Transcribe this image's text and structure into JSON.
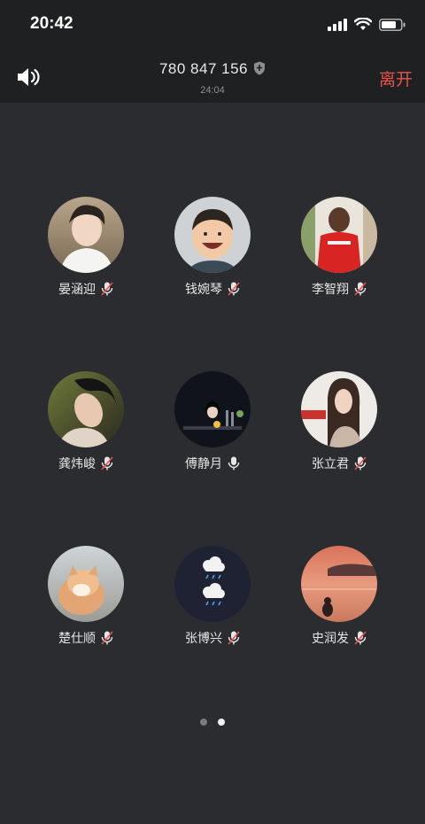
{
  "status": {
    "time": "20:42"
  },
  "header": {
    "meeting_id": "780 847 156",
    "duration": "24:04",
    "leave_label": "离开"
  },
  "participants": [
    {
      "name": "晏涵迎",
      "muted": true
    },
    {
      "name": "钱婉琴",
      "muted": true
    },
    {
      "name": "李智翔",
      "muted": true
    },
    {
      "name": "龚炜峻",
      "muted": true
    },
    {
      "name": "傅静月",
      "muted": false
    },
    {
      "name": "张立君",
      "muted": true
    },
    {
      "name": "楚仕顺",
      "muted": true
    },
    {
      "name": "张博兴",
      "muted": true
    },
    {
      "name": "史润发",
      "muted": true
    }
  ],
  "pager": {
    "pages": 2,
    "current": 2
  },
  "colors": {
    "background": "#2b2c2f",
    "header": "#1f2022",
    "leave": "#e8534b",
    "muted_slash": "#e8534b"
  },
  "icons": [
    "speaker-icon",
    "shield-icon",
    "mic-muted-icon",
    "mic-icon",
    "signal-icon",
    "wifi-icon",
    "battery-icon"
  ]
}
